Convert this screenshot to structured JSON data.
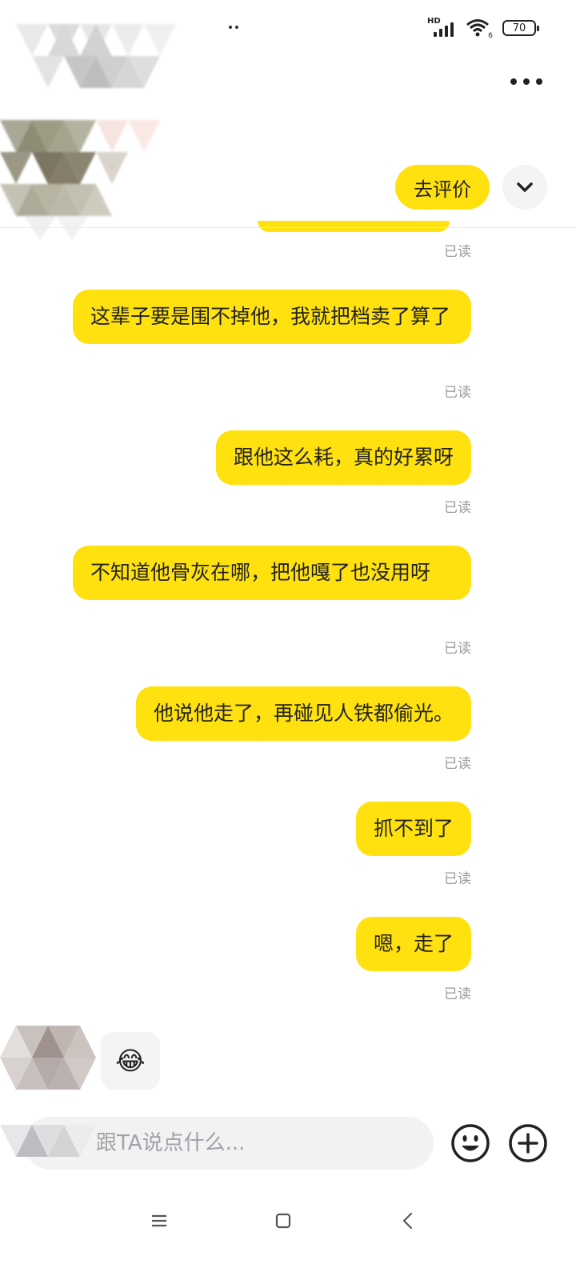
{
  "status_bar": {
    "network_label": "HD",
    "wifi_label": "6",
    "battery_level": "70"
  },
  "header": {
    "review_button_label": "去评价",
    "more_icon": "more-horizontal-icon",
    "collapse_icon": "chevron-down-icon"
  },
  "messages": [
    {
      "text": "这辈子要是围不掉他，我就把档卖了算了",
      "status": "已读"
    },
    {
      "text": "跟他这么耗，真的好累呀",
      "status": "已读"
    },
    {
      "text": "不知道他骨灰在哪，把他嘎了也没用呀",
      "status": "已读"
    },
    {
      "text": "他说他走了，再碰见人铁都偷光。",
      "status": "已读"
    },
    {
      "text": "抓不到了",
      "status": "已读"
    },
    {
      "text": "嗯，走了",
      "status": "已读"
    }
  ],
  "first_status": "已读",
  "incoming": {
    "emoji": "😂"
  },
  "composer": {
    "placeholder": "跟TA说点什么...",
    "emoji_icon": "smiley-icon",
    "plus_icon": "plus-circle-icon"
  },
  "colors": {
    "bubble": "#ffe10f",
    "read_text": "#9a9a9a"
  }
}
